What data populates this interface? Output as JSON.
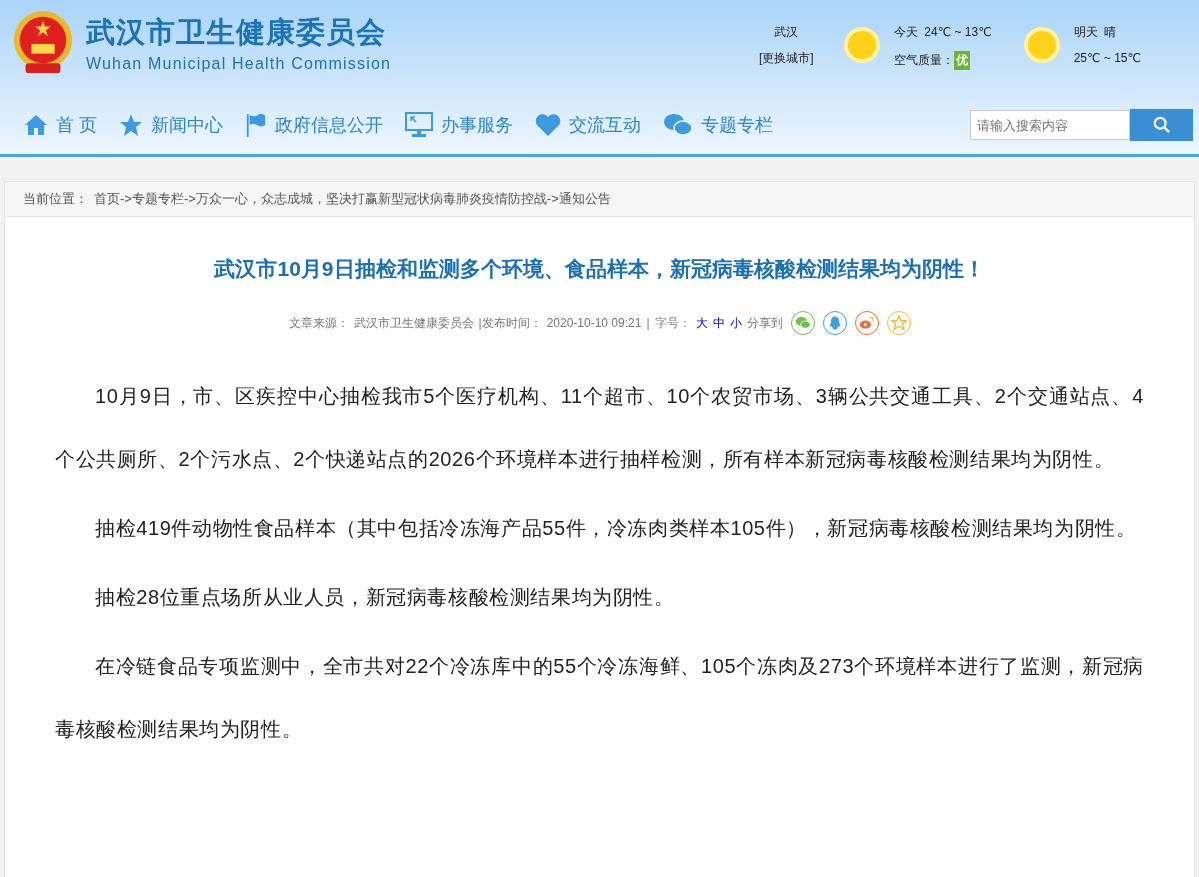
{
  "site": {
    "title": "武汉市卫生健康委员会",
    "subtitle": "Wuhan Municipal Health Commission"
  },
  "weather": {
    "city": "武汉",
    "change_city": "[更换城市]",
    "today_label": "今天",
    "today_temp": "24℃ ~ 13℃",
    "air_label": "空气质量：",
    "air_value": "优",
    "tomorrow_label": "明天",
    "tomorrow_weather": "晴",
    "tomorrow_temp": "25℃ ~ 15℃"
  },
  "nav": [
    {
      "label": "首 页",
      "kind": "home"
    },
    {
      "label": "新闻中心",
      "kind": "star"
    },
    {
      "label": "政府信息公开",
      "kind": "flag"
    },
    {
      "label": "办事服务",
      "kind": "monitor"
    },
    {
      "label": "交流互动",
      "kind": "heart"
    },
    {
      "label": "专题专栏",
      "kind": "chat"
    }
  ],
  "search": {
    "placeholder": "请输入搜索内容"
  },
  "breadcrumb": {
    "label": "当前位置：",
    "path": "首页->专题专栏->万众一心，众志成城，坚决打赢新型冠状病毒肺炎疫情防控战->通知公告"
  },
  "article": {
    "title": "武汉市10月9日抽检和监测多个环境、食品样本，新冠病毒核酸检测结果均为阴性！",
    "source_label": "文章来源：",
    "source": "武汉市卫生健康委员会",
    "time_label": "|发布时间：",
    "time": "2020-10-10 09:21",
    "sep": "|",
    "size_label": "字号：",
    "sizes": [
      "大",
      "中",
      "小"
    ],
    "share_label": "分享到",
    "share": [
      {
        "kind": "wechat",
        "color": "#6cc04a"
      },
      {
        "kind": "qq",
        "color": "#3ca0e0"
      },
      {
        "kind": "weibo",
        "color": "#f06a35"
      },
      {
        "kind": "star",
        "color": "#f5b82e"
      }
    ],
    "paragraphs": [
      "10月9日，市、区疾控中心抽检我市5个医疗机构、11个超市、10个农贸市场、3辆公共交通工具、2个交通站点、4个公共厕所、2个污水点、2个快递站点的2026个环境样本进行抽样检测，所有样本新冠病毒核酸检测结果均为阴性。",
      "抽检419件动物性食品样本（其中包括冷冻海产品55件，冷冻肉类样本105件），新冠病毒核酸检测结果均为阴性。",
      "抽检28位重点场所从业人员，新冠病毒核酸检测结果均为阴性。",
      "在冷链食品专项监测中，全市共对22个冷冻库中的55个冷冻海鲜、105个冻肉及273个环境样本进行了监测，新冠病毒核酸检测结果均为阴性。"
    ]
  }
}
